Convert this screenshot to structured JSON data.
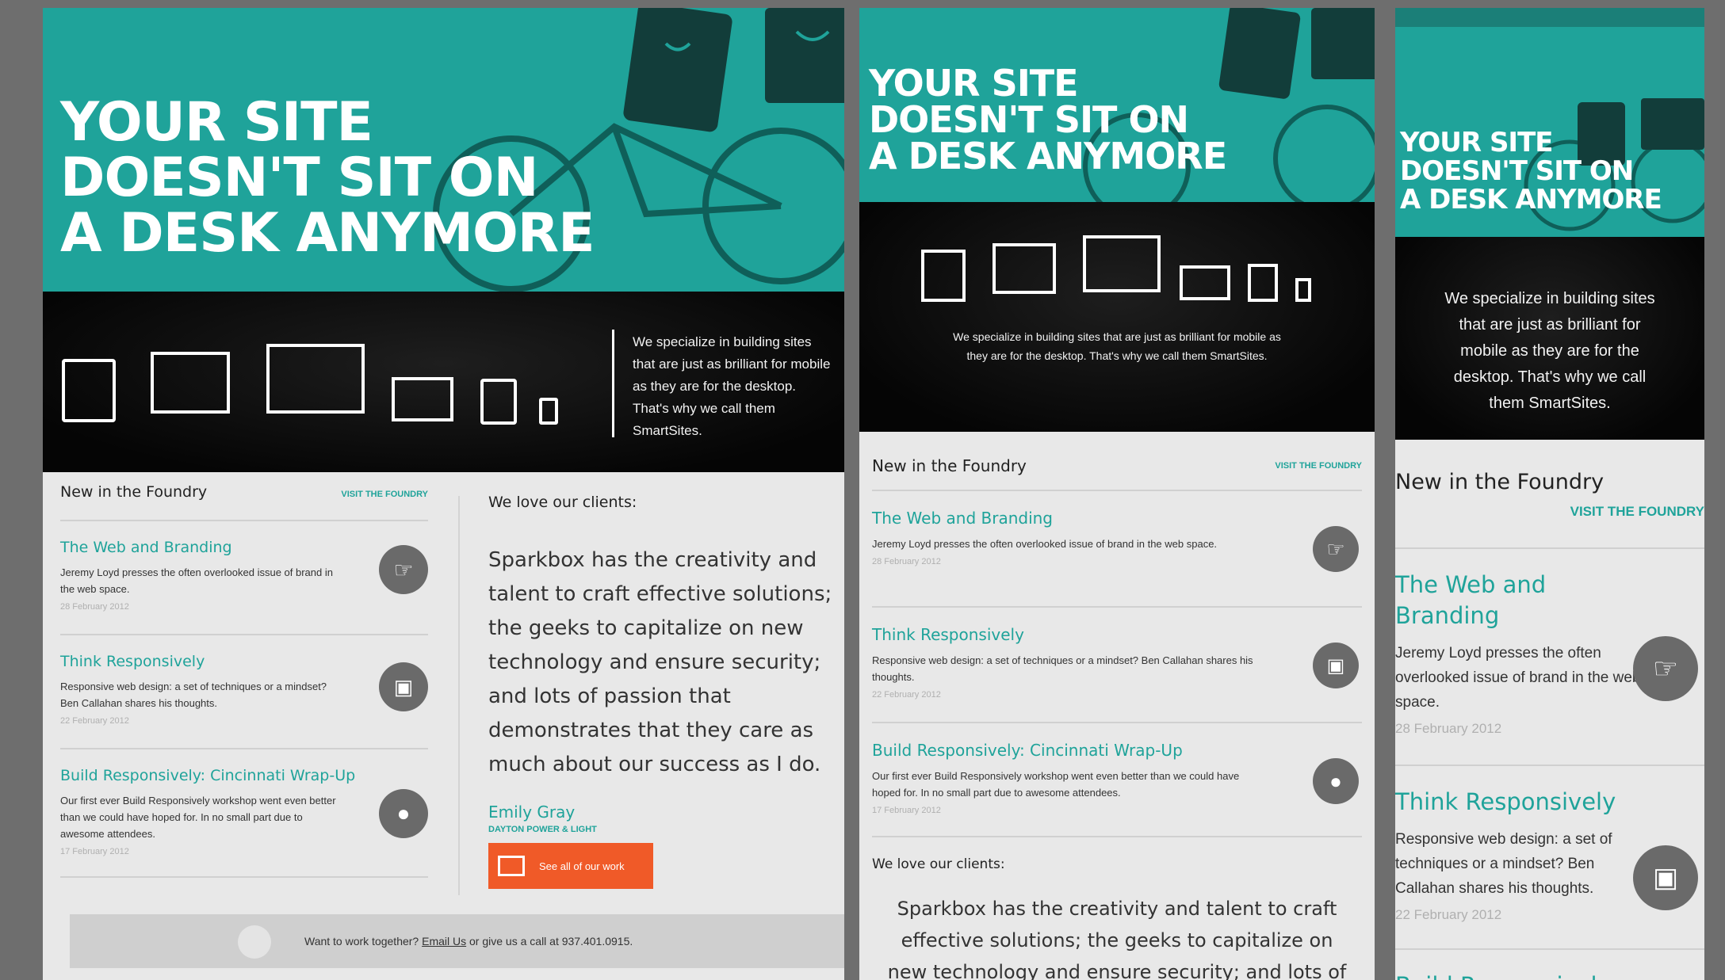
{
  "hero": {
    "line1": "YOUR SITE",
    "line2": "DOESN'T SIT ON",
    "line3": "A DESK ANYMORE"
  },
  "tagline": "We specialize in building sites that are just as brilliant for mobile as they are for the desktop. That's why we call them SmartSites.",
  "foundry": {
    "title": "New in the Foundry",
    "link": "VISIT THE FOUNDRY",
    "posts": [
      {
        "title": "The Web and Branding",
        "excerpt": "Jeremy Loyd presses the often overlooked issue of brand in the web space.",
        "date": "28 February 2012",
        "icon": "pointer-icon"
      },
      {
        "title": "Think Responsively",
        "excerpt": "Responsive web design: a set of techniques or a mindset? Ben Callahan shares his thoughts.",
        "date": "22 February 2012",
        "icon": "devices-icon"
      },
      {
        "title": "Build Responsively: Cincinnati Wrap-Up",
        "excerpt": "Our first ever Build Responsively workshop went even better than we could have hoped for. In no small part due to awesome attendees.",
        "date": "17 February 2012",
        "icon": "apple-icon"
      }
    ]
  },
  "clients": {
    "title": "We love our clients:",
    "quote": "Sparkbox has the creativity and talent to craft effective solutions; the geeks to capitalize on new technology and ensure security; and lots of passion that demonstrates that they care as much about our success as I do.",
    "quote_narrow": "Sparkbox has the creativity and talent to craft effective solutions; the geeks to capitalize on new technology and ensure security; and lots of passion",
    "author": "Emily Gray",
    "company": "DAYTON POWER & LIGHT",
    "cta": "See all of our work"
  },
  "footer": {
    "text_before": "Want to work together?",
    "link": "Email Us",
    "text_after": "or give us a call at 937.401.0915."
  },
  "partial_title": "Build Responsively:",
  "colors": {
    "teal": "#1fa39a",
    "orange": "#f05a28",
    "dark": "#050505"
  }
}
